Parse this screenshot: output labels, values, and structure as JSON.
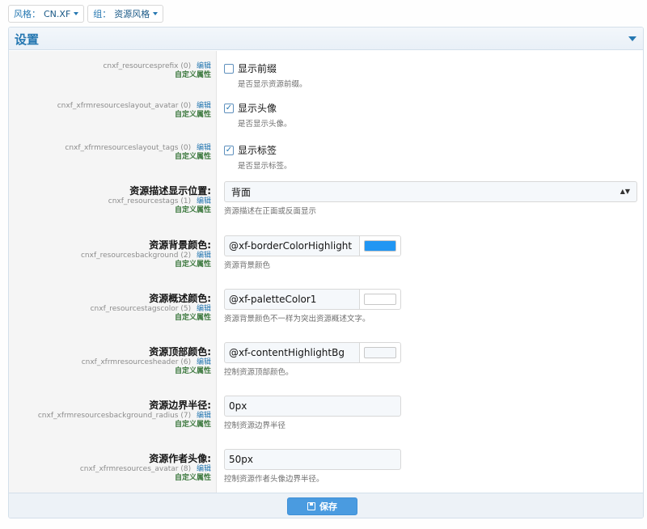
{
  "topbar": {
    "style": {
      "label": "风格：",
      "value": "CN.XF"
    },
    "group": {
      "label": "组：",
      "value": "资源风格"
    }
  },
  "panel": {
    "title": "设置"
  },
  "rows": [
    {
      "type": "checkbox",
      "title": "",
      "key": "cnxf_resourcesprefix",
      "order": "(0)",
      "edit": "编辑",
      "custom": "自定义属性",
      "label": "显示前缀",
      "checked": false,
      "check_mark": "",
      "hint": "是否显示资源前缀。"
    },
    {
      "type": "checkbox",
      "title": "",
      "key": "cnxf_xfrmresourceslayout_avatar",
      "order": "(0)",
      "edit": "编辑",
      "custom": "自定义属性",
      "label": "显示头像",
      "checked": true,
      "check_mark": "✓",
      "hint": "是否显示头像。"
    },
    {
      "type": "checkbox",
      "title": "",
      "key": "cnxf_xfrmresourceslayout_tags",
      "order": "(0)",
      "edit": "编辑",
      "custom": "自定义属性",
      "label": "显示标签",
      "checked": true,
      "check_mark": "✓",
      "hint": "是否显示标签。"
    },
    {
      "type": "select",
      "title": "资源描述显示位置:",
      "key": "cnxf_resourcestags",
      "order": "(1)",
      "edit": "编辑",
      "custom": "自定义属性",
      "value": "背面",
      "arrows": "▲▼",
      "hint": "资源描述在正面或反面显示"
    },
    {
      "type": "color",
      "title": "资源背景颜色:",
      "key": "cnxf_resourcesbackground",
      "order": "(2)",
      "edit": "编辑",
      "custom": "自定义属性",
      "value": "@xf-borderColorHighlight",
      "swatch": "#2196f3",
      "hint": "资源背景颜色"
    },
    {
      "type": "color",
      "title": "资源概述颜色:",
      "key": "cnxf_resourcestagscolor",
      "order": "(5)",
      "edit": "编辑",
      "custom": "自定义属性",
      "value": "@xf-paletteColor1",
      "swatch": "#ffffff",
      "hint": "资源背景颜色不一样为突出资源概述文字。"
    },
    {
      "type": "color",
      "title": "资源顶部颜色:",
      "key": "cnxf_xfrmresourcesheader",
      "order": "(6)",
      "edit": "编辑",
      "custom": "自定义属性",
      "value": "@xf-contentHighlightBg",
      "swatch": "#f5f8fb",
      "hint": "控制资源顶部颜色。"
    },
    {
      "type": "text",
      "title": "资源边界半径:",
      "key": "cnxf_xfrmresourcesbackground_radius",
      "order": "(7)",
      "edit": "编辑",
      "custom": "自定义属性",
      "value": "0px",
      "hint": "控制资源边界半径"
    },
    {
      "type": "text",
      "title": "资源作者头像:",
      "key": "cnxf_xfrmresources_avatar",
      "order": "(8)",
      "edit": "编辑",
      "custom": "自定义属性",
      "value": "50px",
      "hint": "控制资源作者头像边界半径。"
    }
  ],
  "footer": {
    "save_label": "保存"
  },
  "colors": {
    "accent": "#2577b1",
    "button": "#4a9be0",
    "custom_green": "#3d793f"
  }
}
